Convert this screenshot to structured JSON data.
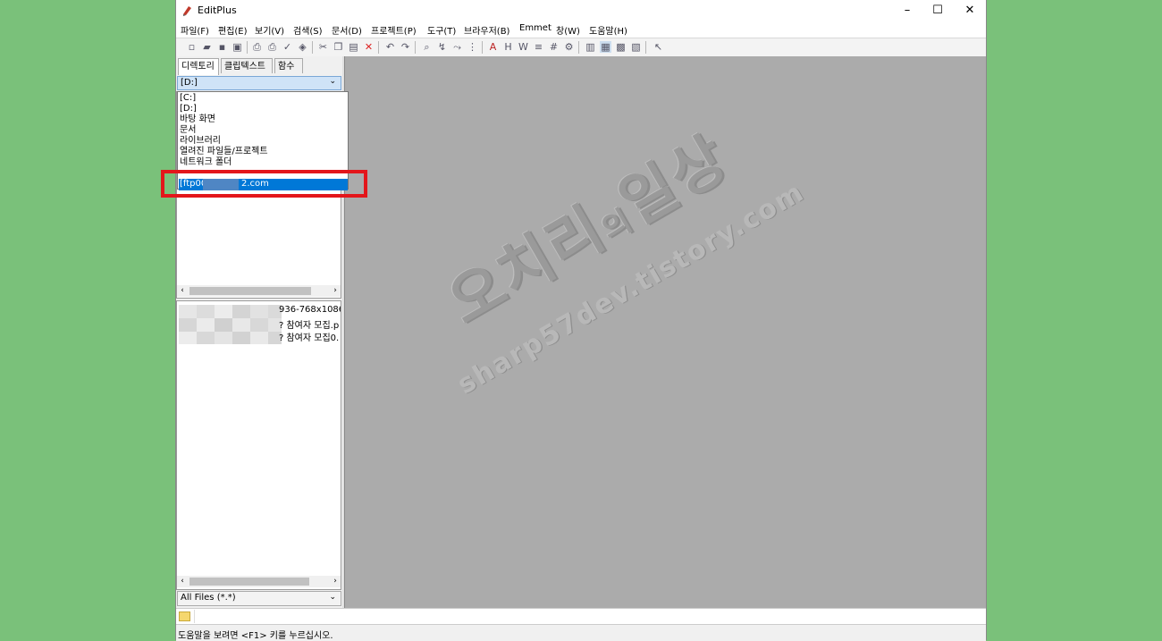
{
  "window": {
    "title": "EditPlus",
    "minimize": "–",
    "maximize": "☐",
    "close": "✕"
  },
  "menu": [
    "파일(F)",
    "편집(E)",
    "보기(V)",
    "검색(S)",
    "문서(D)",
    "프로젝트(P)",
    "도구(T)",
    "브라우저(B)",
    "Emmet",
    "창(W)",
    "도움말(H)"
  ],
  "sidebar": {
    "tabs": [
      "디렉토리",
      "클립텍스트",
      "함수"
    ],
    "drive": "[D:]",
    "dropdown_items": [
      "[C:]",
      "[D:]",
      "바탕 화면",
      "문서",
      "라이브러리",
      "열려진 파일들/프로젝트",
      "네트워크 폴더"
    ],
    "dropdown_selected": "[ftp00",
    "dropdown_selected_suffix": "2.com",
    "files": [
      "936-768x1086.j",
      "? 참여자 모집.p",
      "? 참여자 모집0."
    ],
    "filter": "All Files (*.*)"
  },
  "watermark": {
    "main": "오치리",
    "particle": "의",
    "main2": "일상",
    "url": "sharp57dev.tistory.com"
  },
  "statusbar": {
    "text": "도움말을 보려면 <F1> 키를 누르십시오."
  },
  "icons": {
    "app": "editplus-icon",
    "folder": "folder-icon"
  },
  "colors": {
    "background": "#7ac17a",
    "highlight": "#e3161b",
    "selection": "#0078d7",
    "editor": "#ababab"
  }
}
